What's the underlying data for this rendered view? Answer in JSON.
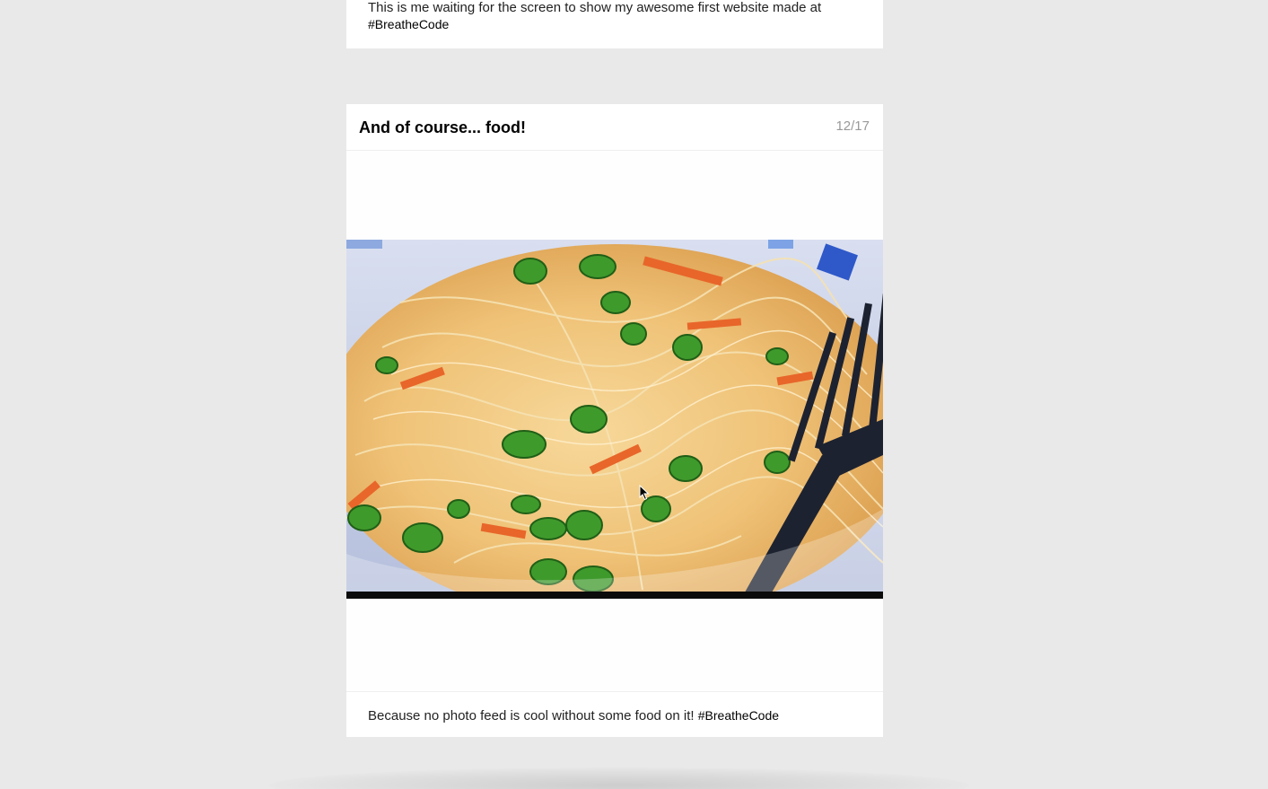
{
  "previous_post": {
    "caption": "This is me waiting for the screen to show my awesome first website made at",
    "hashtag": "#BreatheCode"
  },
  "post": {
    "title": "And of course... food!",
    "counter": "12/17",
    "photo_alt": "And of course... food!",
    "caption": "Because no photo feed is cool without some food on it!",
    "hashtag": "#BreatheCode"
  },
  "colors": {
    "background": "#e9e9e9",
    "card": "#ffffff",
    "counter": "#999999",
    "title": "#000000"
  },
  "icons": [
    "mouse-pointer-icon"
  ]
}
